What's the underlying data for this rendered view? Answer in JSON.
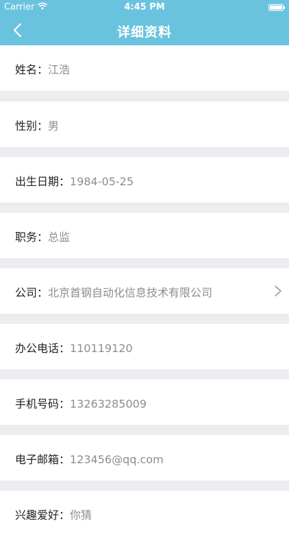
{
  "status_bar": {
    "carrier": "Carrier",
    "time": "4:45 PM",
    "icons": [
      "wifi-icon",
      "battery-icon"
    ]
  },
  "nav": {
    "title": "详细资料",
    "back_icon": "chevron-left-icon"
  },
  "fields": [
    {
      "label": "姓名：",
      "value": "江浩"
    },
    {
      "label": "性别：",
      "value": "男"
    },
    {
      "label": "出生日期：",
      "value": "1984-05-25"
    },
    {
      "label": "职务：",
      "value": "总监"
    },
    {
      "label": "公司：",
      "value": "北京首钢自动化信息技术有限公司",
      "has_chevron": true
    },
    {
      "label": "办公电话：",
      "value": "110119120"
    },
    {
      "label": "手机号码：",
      "value": "13263285009"
    },
    {
      "label": "电子邮箱：",
      "value": "123456@qq.com"
    },
    {
      "label": "兴趣爱好：",
      "value": "你猜"
    }
  ],
  "colors": {
    "accent": "#6ac3de",
    "background": "#ededf1",
    "label": "#222222",
    "value": "#8d8d8d"
  }
}
